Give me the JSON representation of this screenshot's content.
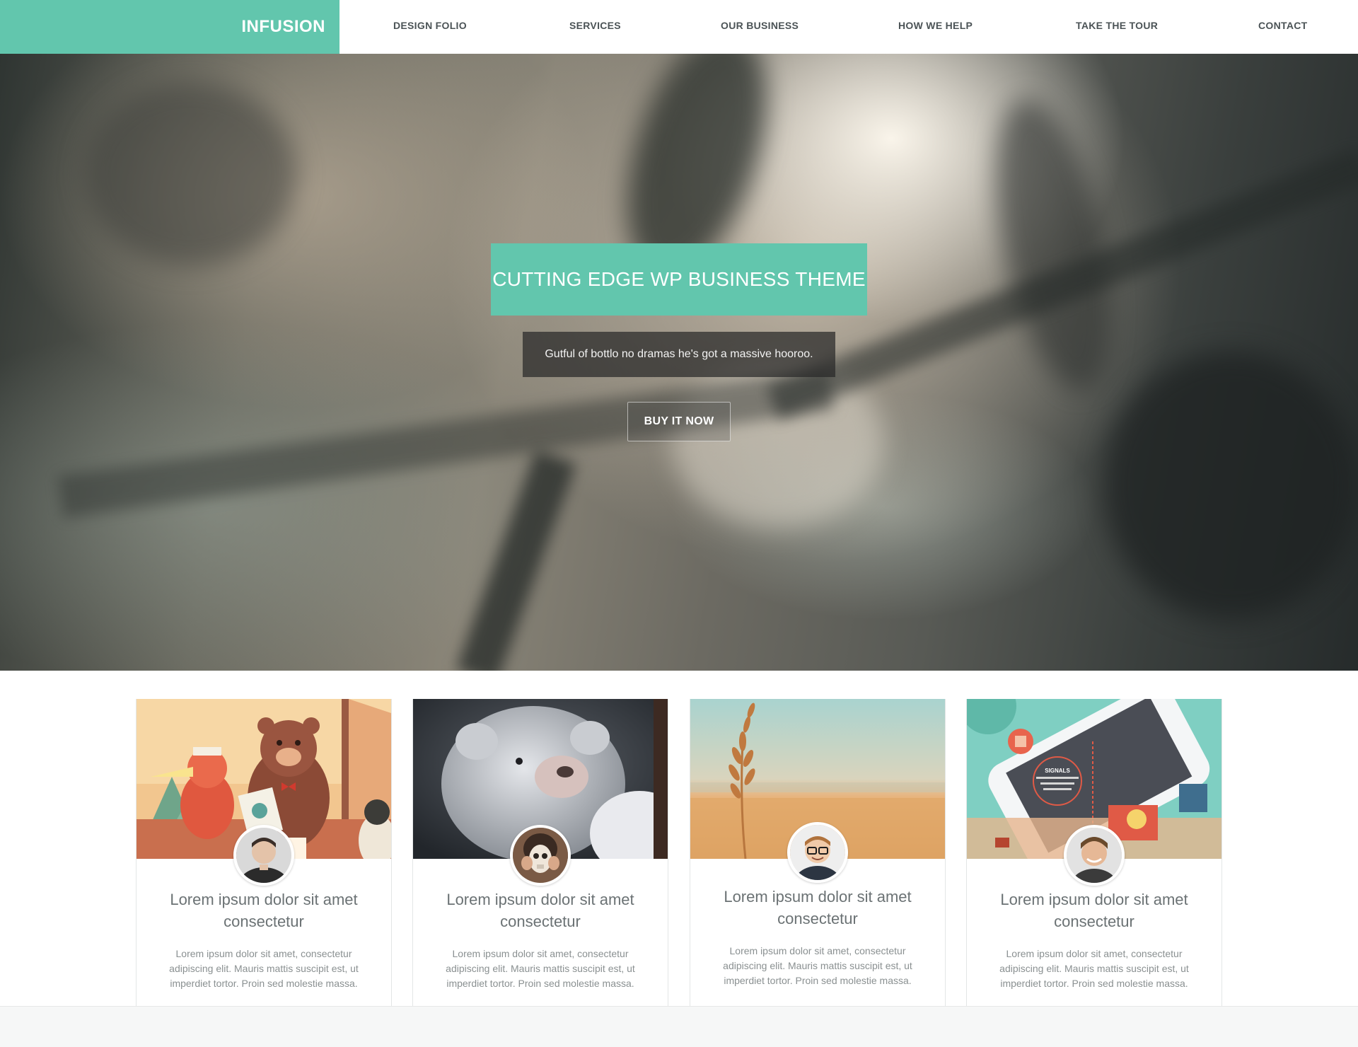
{
  "brand": {
    "name": "INFUSION",
    "color": "#62c6ad"
  },
  "nav": {
    "items": [
      {
        "label": "DESIGN FOLIO"
      },
      {
        "label": "SERVICES"
      },
      {
        "label": "OUR BUSINESS"
      },
      {
        "label": "HOW WE HELP"
      },
      {
        "label": "TAKE THE TOUR"
      },
      {
        "label": "CONTACT"
      }
    ]
  },
  "hero": {
    "title": "CUTTING EDGE WP BUSINESS THEME",
    "subtitle": "Gutful of bottlo no dramas he's got a massive hooroo.",
    "cta": "BUY IT NOW"
  },
  "cards": [
    {
      "image": "illustration-cat-bear-image",
      "avatar": "man-avatar",
      "title": "Lorem ipsum dolor sit amet consectetur",
      "text": "Lorem ipsum dolor sit amet, consectetur adipiscing elit. Mauris mattis suscipit est, ut imperdiet tortor. Proin sed molestie massa."
    },
    {
      "image": "polar-bear-image",
      "avatar": "masked-person-avatar",
      "title": "Lorem ipsum dolor sit amet consectetur",
      "text": "Lorem ipsum dolor sit amet, consectetur adipiscing elit. Mauris mattis suscipit est, ut imperdiet tortor. Proin sed molestie massa."
    },
    {
      "image": "wheat-field-image",
      "avatar": "man-glasses-avatar",
      "title": "Lorem ipsum dolor sit amet consectetur",
      "text": "Lorem ipsum dolor sit amet, consectetur adipiscing elit. Mauris mattis suscipit est, ut imperdiet tortor. Proin sed molestie massa."
    },
    {
      "image": "phone-infographic-image",
      "avatar": "smiling-man-avatar",
      "title": "Lorem ipsum dolor sit amet consectetur",
      "text": "Lorem ipsum dolor sit amet, consectetur adipiscing elit. Mauris mattis suscipit est, ut imperdiet tortor. Proin sed molestie massa.",
      "infographic": {
        "heading": "SIGNALS",
        "caption": "travel from the touch screen to the processor as electrical impulses"
      }
    }
  ],
  "colors": {
    "accent": "#62c6ad",
    "nav_text": "#4b5356",
    "card_title": "#6b7274",
    "card_text": "#8a9091"
  }
}
